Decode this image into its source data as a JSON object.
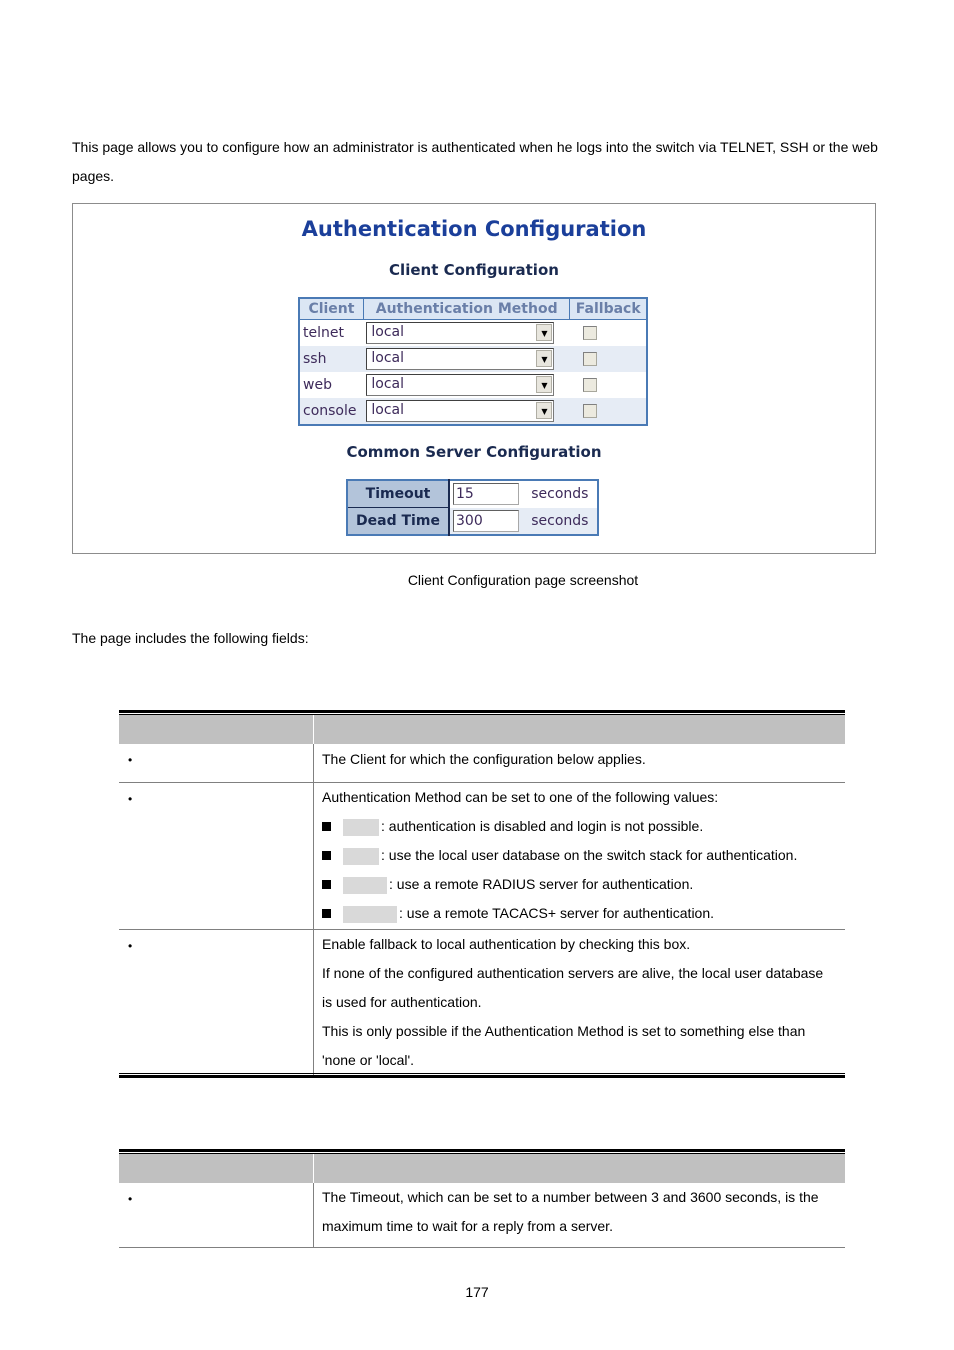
{
  "intro_text": "This page allows you to configure how an administrator is authenticated when he logs into the switch via TELNET, SSH or the web pages.",
  "screenshot": {
    "title": "Authentication Configuration",
    "client_section_title": "Client Configuration",
    "client_table": {
      "headers": [
        "Client",
        "Authentication Method",
        "Fallback"
      ],
      "rows": [
        {
          "client": "telnet",
          "method": "local",
          "fallback": false
        },
        {
          "client": "ssh",
          "method": "local",
          "fallback": false
        },
        {
          "client": "web",
          "method": "local",
          "fallback": false
        },
        {
          "client": "console",
          "method": "local",
          "fallback": false
        }
      ]
    },
    "server_section_title": "Common Server Configuration",
    "server_table": {
      "rows": [
        {
          "label": "Timeout",
          "value": "15",
          "unit": "seconds"
        },
        {
          "label": "Dead Time",
          "value": "300",
          "unit": "seconds"
        }
      ]
    }
  },
  "caption": "Client Configuration page screenshot",
  "fields_intro": "The page includes the following fields:",
  "client_fields_table": {
    "rows": [
      {
        "bullet": "•",
        "lines": [
          "The Client for which the configuration below applies."
        ]
      },
      {
        "bullet": "•",
        "lines": [
          "Authentication Method can be set to one of the following values:"
        ],
        "options": [
          ": authentication is disabled and login is not possible.",
          ": use the local user database on the switch stack for authentication.",
          ": use a remote RADIUS server for authentication.",
          ": use a remote TACACS+ server for authentication."
        ]
      },
      {
        "bullet": "•",
        "lines": [
          "Enable fallback to local authentication by checking this box.",
          "If none of the configured authentication servers are alive, the local user database",
          "is used for authentication.",
          "This is only possible if the Authentication Method is set to something else than",
          "'none or 'local'."
        ]
      }
    ]
  },
  "server_fields_table": {
    "rows": [
      {
        "bullet": "•",
        "lines": [
          "The Timeout, which can be set to a number between 3 and 3600 seconds, is the",
          "maximum time to wait for a reply from a server."
        ]
      }
    ]
  },
  "page_number": "177"
}
